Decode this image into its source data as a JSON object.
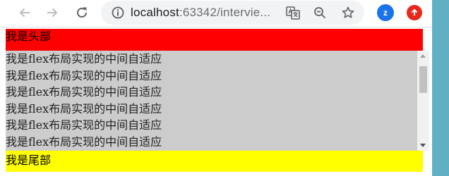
{
  "browser": {
    "url_host": "localhost",
    "url_path": ":63342/intervie...",
    "profile_initial": "z"
  },
  "page": {
    "header_text": "我是头部",
    "main_lines": [
      "我是flex布局实现的中间自适应",
      "我是flex布局实现的中间自适应",
      "我是flex布局实现的中间自适应",
      "我是flex布局实现的中间自适应",
      "我是flex布局实现的中间自适应",
      "我是flex布局实现的中间自适应"
    ],
    "footer_text": "我是尾部"
  },
  "colors": {
    "header_bg": "#ff0000",
    "main_bg": "#cccccc",
    "footer_bg": "#ffff00",
    "profile": "#1a73e8",
    "update_badge": "#e8281b"
  },
  "icons": [
    "back-arrow-icon",
    "forward-arrow-icon",
    "reload-icon",
    "site-info-icon",
    "translate-icon",
    "zoom-out-icon",
    "bookmark-star-icon",
    "update-icon"
  ]
}
